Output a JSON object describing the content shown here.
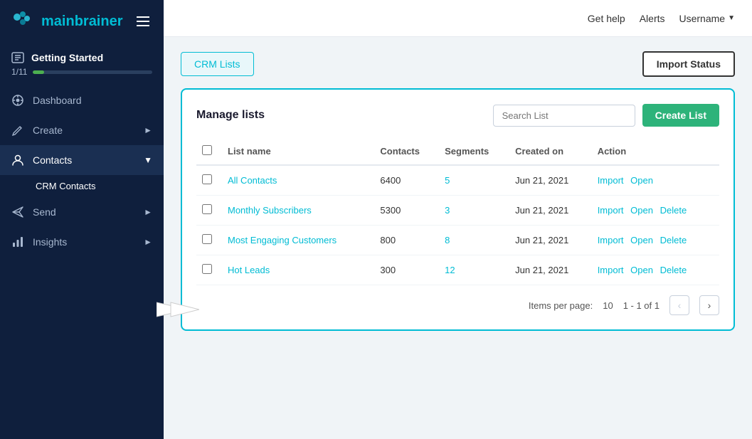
{
  "app": {
    "name_part1": "main",
    "name_part2": "brainer"
  },
  "topnav": {
    "get_help": "Get help",
    "alerts": "Alerts",
    "username": "Username",
    "caret": "▼"
  },
  "sidebar": {
    "getting_started_label": "Getting Started",
    "getting_started_progress": "1/11",
    "progress_percent": 9,
    "items": [
      {
        "id": "dashboard",
        "label": "Dashboard",
        "icon": "dashboard-icon",
        "arrow": false
      },
      {
        "id": "create",
        "label": "Create",
        "icon": "create-icon",
        "arrow": true
      },
      {
        "id": "contacts",
        "label": "Contacts",
        "icon": "contacts-icon",
        "arrow": true,
        "active": true
      },
      {
        "id": "crm-contacts",
        "label": "CRM Contacts",
        "sub": true,
        "active": true
      },
      {
        "id": "send",
        "label": "Send",
        "icon": "send-icon",
        "arrow": true
      },
      {
        "id": "insights",
        "label": "Insights",
        "icon": "insights-icon",
        "arrow": true
      }
    ]
  },
  "page": {
    "tab_crm_lists": "CRM Lists",
    "import_status_btn": "Import Status",
    "manage_lists_title": "Manage lists",
    "search_placeholder": "Search List",
    "create_list_btn": "Create List"
  },
  "table": {
    "columns": [
      "List name",
      "Contacts",
      "Segments",
      "Created on",
      "Action"
    ],
    "rows": [
      {
        "name": "All Contacts",
        "contacts": "6400",
        "segments": "5",
        "created": "Jun 21, 2021",
        "actions": [
          "Import",
          "Open"
        ],
        "has_delete": false
      },
      {
        "name": "Monthly Subscribers",
        "contacts": "5300",
        "segments": "3",
        "created": "Jun 21, 2021",
        "actions": [
          "Import",
          "Open",
          "Delete"
        ],
        "has_delete": true
      },
      {
        "name": "Most Engaging Customers",
        "contacts": "800",
        "segments": "8",
        "created": "Jun 21, 2021",
        "actions": [
          "Import",
          "Open",
          "Delete"
        ],
        "has_delete": true
      },
      {
        "name": "Hot Leads",
        "contacts": "300",
        "segments": "12",
        "created": "Jun 21, 2021",
        "actions": [
          "Import",
          "Open",
          "Delete"
        ],
        "has_delete": true
      }
    ]
  },
  "pagination": {
    "items_per_page_label": "Items per page:",
    "items_per_page_value": "10",
    "range": "1 - 1 of 1"
  }
}
